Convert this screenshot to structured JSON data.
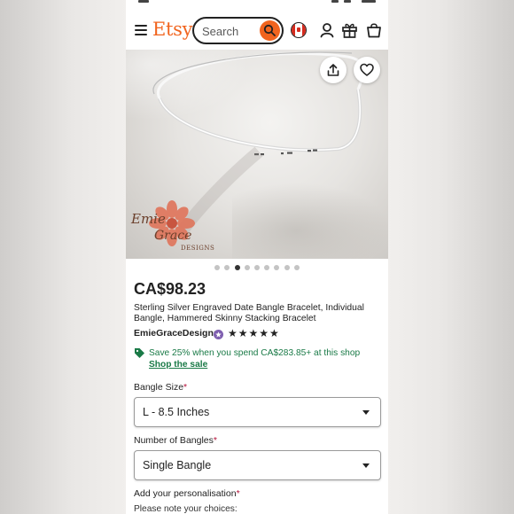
{
  "header": {
    "logo": "Etsy",
    "search_placeholder": "Search"
  },
  "gallery": {
    "dot_count": 9,
    "active_dot": 2,
    "watermark": {
      "line1": "Emie",
      "line2": "Grace",
      "line3": "DESIGNS"
    }
  },
  "product": {
    "price": "CA$98.23",
    "title": "Sterling Silver Engraved Date Bangle Bracelet, Individual Bangle, Hammered Skinny Stacking Bracelet",
    "shop_name": "EmieGraceDesigns",
    "stars": "★★★★★",
    "rating": 5
  },
  "promo": {
    "text": "Save 25% when you spend CA$283.85+ at this shop",
    "link": "Shop the sale"
  },
  "options": {
    "bangle_size_label": "Bangle Size",
    "bangle_size_value": "L - 8.5 Inches",
    "num_bangles_label": "Number of Bangles",
    "num_bangles_value": "Single Bangle",
    "personalisation_label": "Add your personalisation",
    "required_mark": "*",
    "personalisation_note": "Please note your choices:"
  },
  "colors": {
    "brand": "#f1641e",
    "promo_green": "#1a7a47",
    "required": "#b4123a"
  }
}
